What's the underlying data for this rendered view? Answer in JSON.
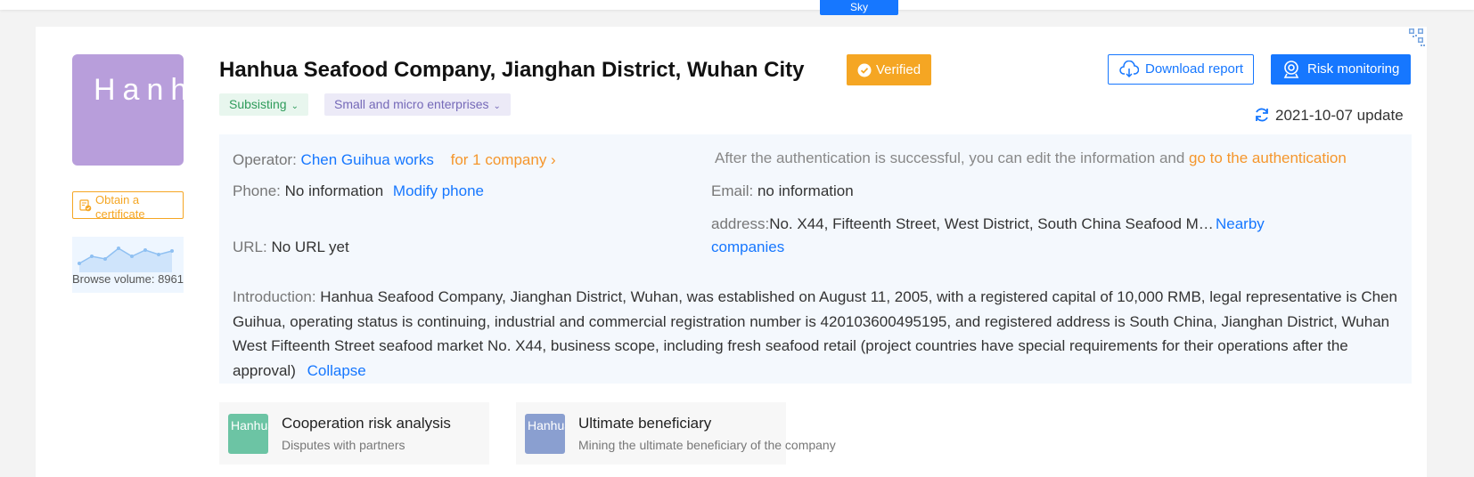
{
  "top_tab": {
    "label": "Sky"
  },
  "company": {
    "logo_text": "Hanhua Seafood",
    "name": "Hanhua Seafood Company, Jianghan District, Wuhan City",
    "verified_label": "Verified",
    "tags": [
      {
        "label": "Subsisting"
      },
      {
        "label": "Small and micro enterprises"
      }
    ]
  },
  "sidebar": {
    "certificate_label": "Obtain a certificate",
    "browse_volume": "Browse volume: 8961"
  },
  "actions": {
    "download_label": "Download report",
    "risk_label": "Risk monitoring",
    "update_text": "2021-10-07 update"
  },
  "info": {
    "operator_label": "Operator:",
    "operator_name": "Chen Guihua works",
    "operator_companies": "for 1 company",
    "auth_notice": "After the authentication is successful, you can edit the information and",
    "auth_link": "go to the authentication",
    "phone_label": "Phone:",
    "phone_value": "No information",
    "phone_modify": "Modify phone",
    "email_label": "Email:",
    "email_value": "no information",
    "address_label": "address:",
    "address_value": "No. X44, Fifteenth Street, West District, South China Seafood M…",
    "nearby_link": "Nearby companies",
    "url_label": "URL:",
    "url_value": "No URL yet",
    "intro_label": "Introduction:",
    "intro_text": "Hanhua Seafood Company, Jianghan District, Wuhan, was established on August 11, 2005, with a registered capital of 10,000 RMB, legal representative is Chen Guihua, operating status is continuing, industrial and commercial registration number is 420103600495195, and registered address is South China, Jianghan District, Wuhan West Fifteenth Street seafood market No. X44, business scope, including fresh seafood retail (project countries have special requirements for their operations after the approval)",
    "collapse_link": "Collapse"
  },
  "cards": [
    {
      "logo_text": "Hanhua Seafood",
      "logo_color": "#6cc4a4",
      "title": "Cooperation risk analysis",
      "subtitle": "Disputes with partners"
    },
    {
      "logo_text": "Hanhua Seafood",
      "logo_color": "#8a9fd0",
      "title": "Ultimate beneficiary",
      "subtitle": "Mining the ultimate beneficiary of the company"
    }
  ],
  "colors": {
    "primary": "#1677ff",
    "accent_orange": "#f5a623",
    "logo_purple": "#b89edb"
  }
}
